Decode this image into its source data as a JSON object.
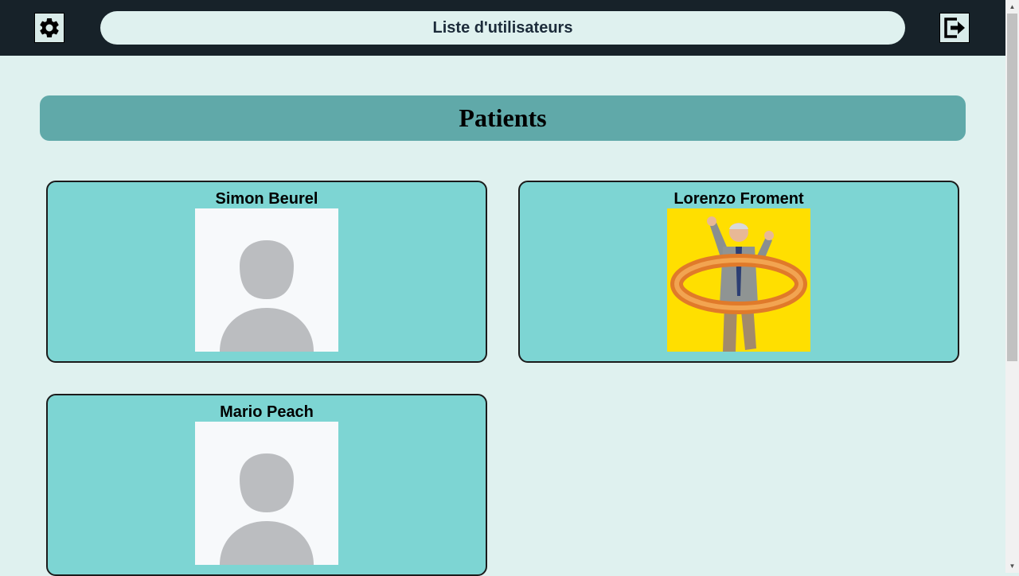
{
  "header": {
    "title": "Liste d'utilisateurs",
    "settings_icon": "gear-icon",
    "logout_icon": "logout-icon"
  },
  "section": {
    "title": "Patients"
  },
  "patients": [
    {
      "name": "Simon Beurel",
      "photo": "default-avatar"
    },
    {
      "name": "Lorenzo Froment",
      "photo": "elderly-man-with-inflatable-ring-on-yellow"
    },
    {
      "name": "Mario Peach",
      "photo": "default-avatar"
    }
  ],
  "colors": {
    "header_bg": "#172229",
    "page_bg": "#dff1ef",
    "banner_bg": "#60a9a9",
    "card_bg": "#7dd5d3",
    "photo_yellow": "#ffdf00"
  }
}
